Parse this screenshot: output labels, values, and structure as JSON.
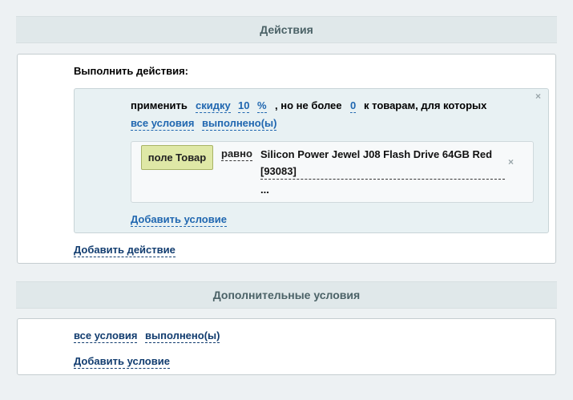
{
  "actions_section": {
    "header": "Действия",
    "title": "Выполнить действия:",
    "action": {
      "verb": "применить",
      "type_link": "скидку",
      "amount_link": "10",
      "unit_link": "%",
      "limit_text": ", но не более",
      "limit_link": "0",
      "target_text": "к товарам, для которых",
      "cond_all_link": "все условия",
      "cond_state_link": "выполнено(ы)",
      "condition": {
        "field_button": "поле Товар",
        "operator_link": "равно",
        "value": "Silicon Power Jewel J08 Flash Drive 64GB Red [93083]",
        "more": "..."
      },
      "add_condition_link": "Добавить условие"
    },
    "add_action_link": "Добавить действие"
  },
  "extra_section": {
    "header": "Дополнительные условия",
    "cond_all_link": "все условия",
    "cond_state_link": "выполнено(ы)",
    "add_condition_link": "Добавить условие"
  },
  "icons": {
    "close_glyph": "×"
  }
}
